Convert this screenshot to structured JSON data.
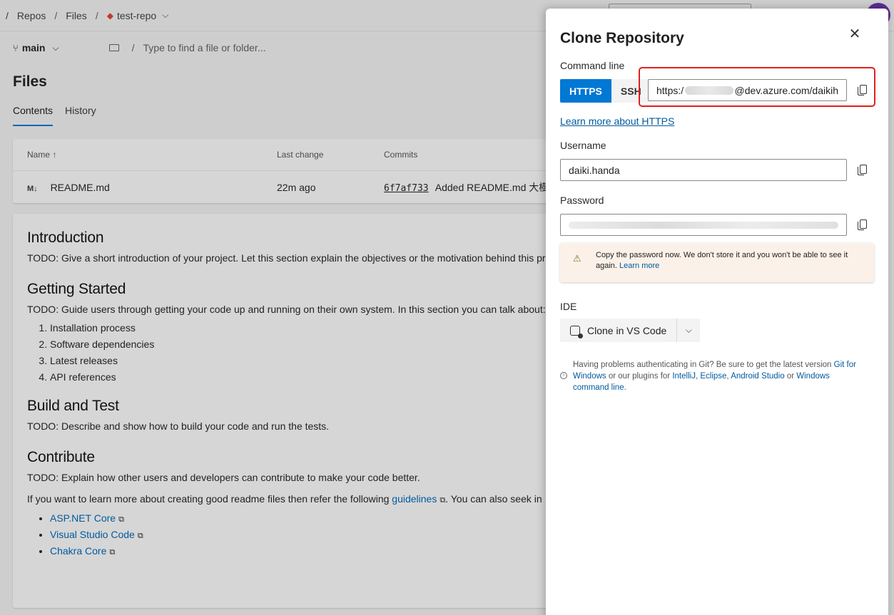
{
  "topbar": {
    "crumbs": [
      "Repos",
      "Files",
      "test-repo"
    ],
    "leading_sep": "/",
    "sep": "/"
  },
  "branchbar": {
    "branch": "main",
    "path_placeholder": "Type to find a file or folder..."
  },
  "files": {
    "title": "Files",
    "tabs": [
      "Contents",
      "History"
    ],
    "columns": [
      "Name ↑",
      "Last change",
      "Commits"
    ],
    "rows": [
      {
        "icon": "M↓",
        "name": "README.md",
        "last_change": "22m ago",
        "hash": "6f7af733",
        "message": "Added README.md 大樹"
      }
    ]
  },
  "readme": {
    "intro_h": "Introduction",
    "intro_p": "TODO: Give a short introduction of your project. Let this section explain the objectives or the motivation behind this pr",
    "gs_h": "Getting Started",
    "gs_p": "TODO: Guide users through getting your code up and running on their own system. In this section you can talk about:",
    "gs_list": [
      "Installation process",
      "Software dependencies",
      "Latest releases",
      "API references"
    ],
    "bt_h": "Build and Test",
    "bt_p": "TODO: Describe and show how to build your code and run the tests.",
    "c_h": "Contribute",
    "c_p": "TODO: Explain how other users and developers can contribute to make your code better.",
    "more_pre": "If you want to learn more about creating good readme files then refer the following ",
    "more_link": "guidelines",
    "more_post": ". You can also seek in",
    "links": [
      "ASP.NET Core",
      "Visual Studio Code",
      "Chakra Core"
    ]
  },
  "dialog": {
    "title": "Clone Repository",
    "command_line_label": "Command line",
    "https_label": "HTTPS",
    "ssh_label": "SSH",
    "url_prefix": "https:/",
    "url_suffix": "@dev.azure.com/daikih",
    "learn_https": "Learn more about HTTPS",
    "username_label": "Username",
    "username_value": "daiki.handa",
    "password_label": "Password",
    "warning_text": "Copy the password now. We don't store it and you won't be able to see it again. ",
    "warning_link": "Learn more",
    "ide_label": "IDE",
    "ide_button": "Clone in VS Code",
    "help_pre": "Having problems authenticating in Git? Be sure to get the latest version ",
    "help_link1": "Git for Windows",
    "help_mid1": " or our plugins for ",
    "help_link2": "IntelliJ",
    "help_mid2": ", ",
    "help_link3": "Eclipse",
    "help_mid3": ", ",
    "help_link4": "Android Studio",
    "help_mid4": " or ",
    "help_link5": "Windows command line",
    "help_end": "."
  },
  "colors": {
    "accent": "#0078d4",
    "highlight": "#e0201e",
    "warning_bg": "#fbf1e9"
  }
}
